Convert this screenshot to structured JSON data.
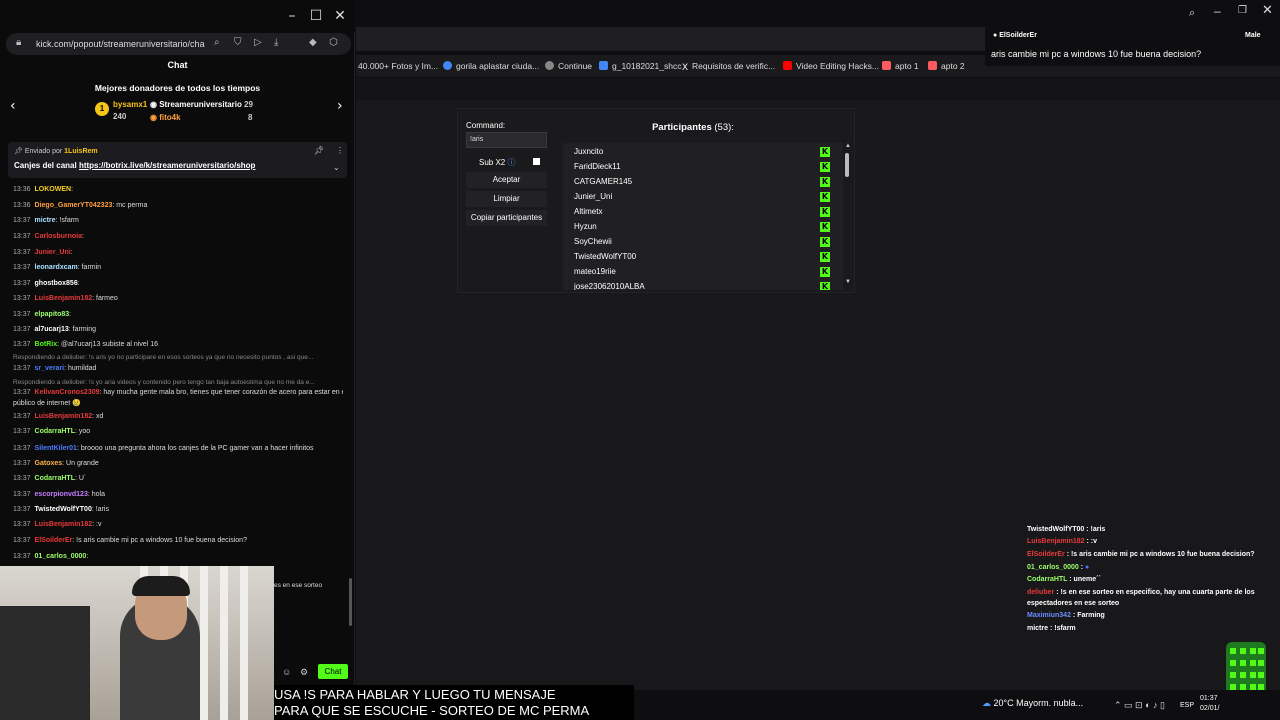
{
  "popout": {
    "url": "kick.com/popout/streameruniversitario/cha",
    "chat_title": "Chat",
    "donors": {
      "title": "Mejores donadores de todos los tiempos",
      "first": {
        "name": "bysamx1",
        "amount": "240"
      },
      "second": {
        "name": "Streameruniversitario",
        "amount": "29"
      },
      "third": {
        "name": "fito4k",
        "amount": "8"
      }
    },
    "pinned": {
      "sent_by": "Enviado por",
      "user": "1LuisRem",
      "text": "Canjes del canal",
      "link": "https://botrix.live/k/streameruniversitario/shop"
    },
    "messages": [
      {
        "time": "13:36",
        "user": "LOKOWEN",
        "text": "",
        "color": "#f5d020"
      },
      {
        "time": "13:36",
        "user": "Diego_GamerYT042323",
        "text": "mc perma",
        "color": "#ff9f3f"
      },
      {
        "time": "13:37",
        "user": "mictre",
        "text": "!sfarm",
        "color": "#a8e0ff"
      },
      {
        "time": "13:37",
        "user": "Carlosburnoia",
        "text": "",
        "color": "#e83a3a"
      },
      {
        "time": "13:37",
        "user": "Junier_Uni",
        "text": "",
        "color": "#e83a3a"
      },
      {
        "time": "13:37",
        "user": "leonardxcam",
        "text": "farmin",
        "color": "#a8e0ff"
      },
      {
        "time": "13:37",
        "user": "ghostbox856",
        "text": "",
        "color": "#ffffff"
      },
      {
        "time": "13:37",
        "user": "LuisBenjamin182",
        "text": "farmeo",
        "color": "#e83a3a"
      },
      {
        "time": "13:37",
        "user": "elpapito83",
        "text": "",
        "color": "#9cff6a"
      },
      {
        "time": "13:37",
        "user": "al7ucarj13",
        "text": "farming",
        "color": "#ffffff"
      },
      {
        "time": "13:37",
        "user": "BotRix",
        "text": "@al7ucarj13 subiste al nivel 16",
        "color": "#53fc18"
      },
      {
        "reply": "Respondiendo a deliuber: !s aris yo no participare en esos sorteos ya que no necesito puntos , asi que..."
      },
      {
        "time": "13:37",
        "user": "sr_verari",
        "text": "humildad",
        "color": "#4a7cff"
      },
      {
        "reply": "Respondiendo a deliuber: !s yo aria videos y contenido pero tengo tan baja autoestima que no me da e..."
      },
      {
        "time": "13:37",
        "user": "KelivanCronos2309",
        "text": "hay mucha gente mala bro, tienes que tener corazón de acero para estar en el",
        "color": "#e83a3a"
      },
      {
        "cont": "público de internet 😢"
      },
      {
        "time": "13:37",
        "user": "LuisBenjamin182",
        "text": "xd",
        "color": "#e83a3a"
      },
      {
        "time": "13:37",
        "user": "CodarraHTL",
        "text": "yoo",
        "color": "#9cff6a"
      },
      {
        "time": "13:37",
        "user": "SilentKiler01",
        "text": "broooo una pregunta ahora los canjes de la PC gamer van a hacer infinitos",
        "color": "#4a7cff"
      },
      {
        "time": "13:37",
        "user": "Gatoxes",
        "text": "Un grande",
        "color": "#ffb347"
      },
      {
        "time": "13:37",
        "user": "CodarraHTL",
        "text": "U´",
        "color": "#9cff6a"
      },
      {
        "time": "13:37",
        "user": "escorpionvd123",
        "text": "hola",
        "color": "#c77dff"
      },
      {
        "time": "13:37",
        "user": "TwistedWolfYT00",
        "text": "!aris",
        "color": "#ffffff"
      },
      {
        "time": "13:37",
        "user": "LuisBenjamin182",
        "text": ":v",
        "color": "#e83a3a"
      },
      {
        "time": "13:37",
        "user": "ElSoilderEr",
        "text": "!s aris cambie mi pc a windows 10 fue buena decision?",
        "color": "#e83a3a"
      },
      {
        "time": "13:37",
        "user": "01_carlos_0000",
        "text": "",
        "color": "#9cff6a"
      }
    ],
    "partial_text": "es en ese sorteo",
    "chat_button": "Chat"
  },
  "bookmarks": [
    {
      "label": "40.000+ Fotos y Im...",
      "color": ""
    },
    {
      "label": "gorila aplastar ciuda...",
      "color": "#4285f4"
    },
    {
      "label": "Continue",
      "color": "#888888"
    },
    {
      "label": "g_10182021_shcc",
      "color": "#4285f4"
    },
    {
      "label": "Requisitos de verific...",
      "color": "#ffffff"
    },
    {
      "label": "Video Editing Hacks...",
      "color": "#ff0000"
    },
    {
      "label": "apto 1",
      "color": "#ff5a5f"
    },
    {
      "label": "apto 2",
      "color": "#ff5a5f"
    }
  ],
  "giveaway": {
    "command_label": "Command:",
    "command_value": "!aris",
    "sub_label": "Sub X2",
    "accept": "Aceptar",
    "clear": "Limpiar",
    "copy": "Copiar participantes",
    "participants_label": "Participantes",
    "participants_count": "(53):",
    "participants": [
      "Juxncito",
      "FaridDieck11",
      "CATGAMER145",
      "Junier_Uni",
      "Altimetx",
      "Hyzun",
      "SoyChewii",
      "TwistedWolfYT00",
      "mateo19riie",
      "jose23062010ALBA"
    ]
  },
  "notification": {
    "user": "ElSoilderEr",
    "message": "aris cambie mi pc a windows 10 fue buena decision?",
    "tag": "Male"
  },
  "overlay_chat": [
    {
      "user": "TwistedWolfYT00",
      "text": ": !aris",
      "color": "#ffffff"
    },
    {
      "user": "LuisBenjamin182",
      "text": ": :v",
      "color": "#e83a3a"
    },
    {
      "user": "ElSoilderEr",
      "text": ": !s aris cambie mi pc a windows 10 fue buena decision?",
      "color": "#e83a3a"
    },
    {
      "user": "01_carlos_0000",
      "text": ":",
      "color": "#9cff6a"
    },
    {
      "user": "CodarraHTL",
      "text": ": uneme´´",
      "color": "#9cff6a"
    },
    {
      "user": "deliuber",
      "text": ": !s en ese sorteo en especifico, hay una cuarta parte de los",
      "color": "#e83a3a"
    },
    {
      "user": "",
      "text": "espectadores en ese sorteo",
      "color": "#ffffff"
    },
    {
      "user": "Maximiun342",
      "text": ": Farming",
      "color": "#6a8cff"
    },
    {
      "user": "mictre",
      "text": ": !sfarm",
      "color": "#ffffff"
    }
  ],
  "subtitle": {
    "line1": "USA !S PARA HABLAR Y LUEGO TU MENSAJE",
    "line2": "PARA QUE SE ESCUCHE - SORTEO DE MC PERMA"
  },
  "taskbar": {
    "temperature": "20°C",
    "weather": "Mayorm. nubla...",
    "lang": "ESP",
    "time": "01:37",
    "date": "02/01/"
  }
}
